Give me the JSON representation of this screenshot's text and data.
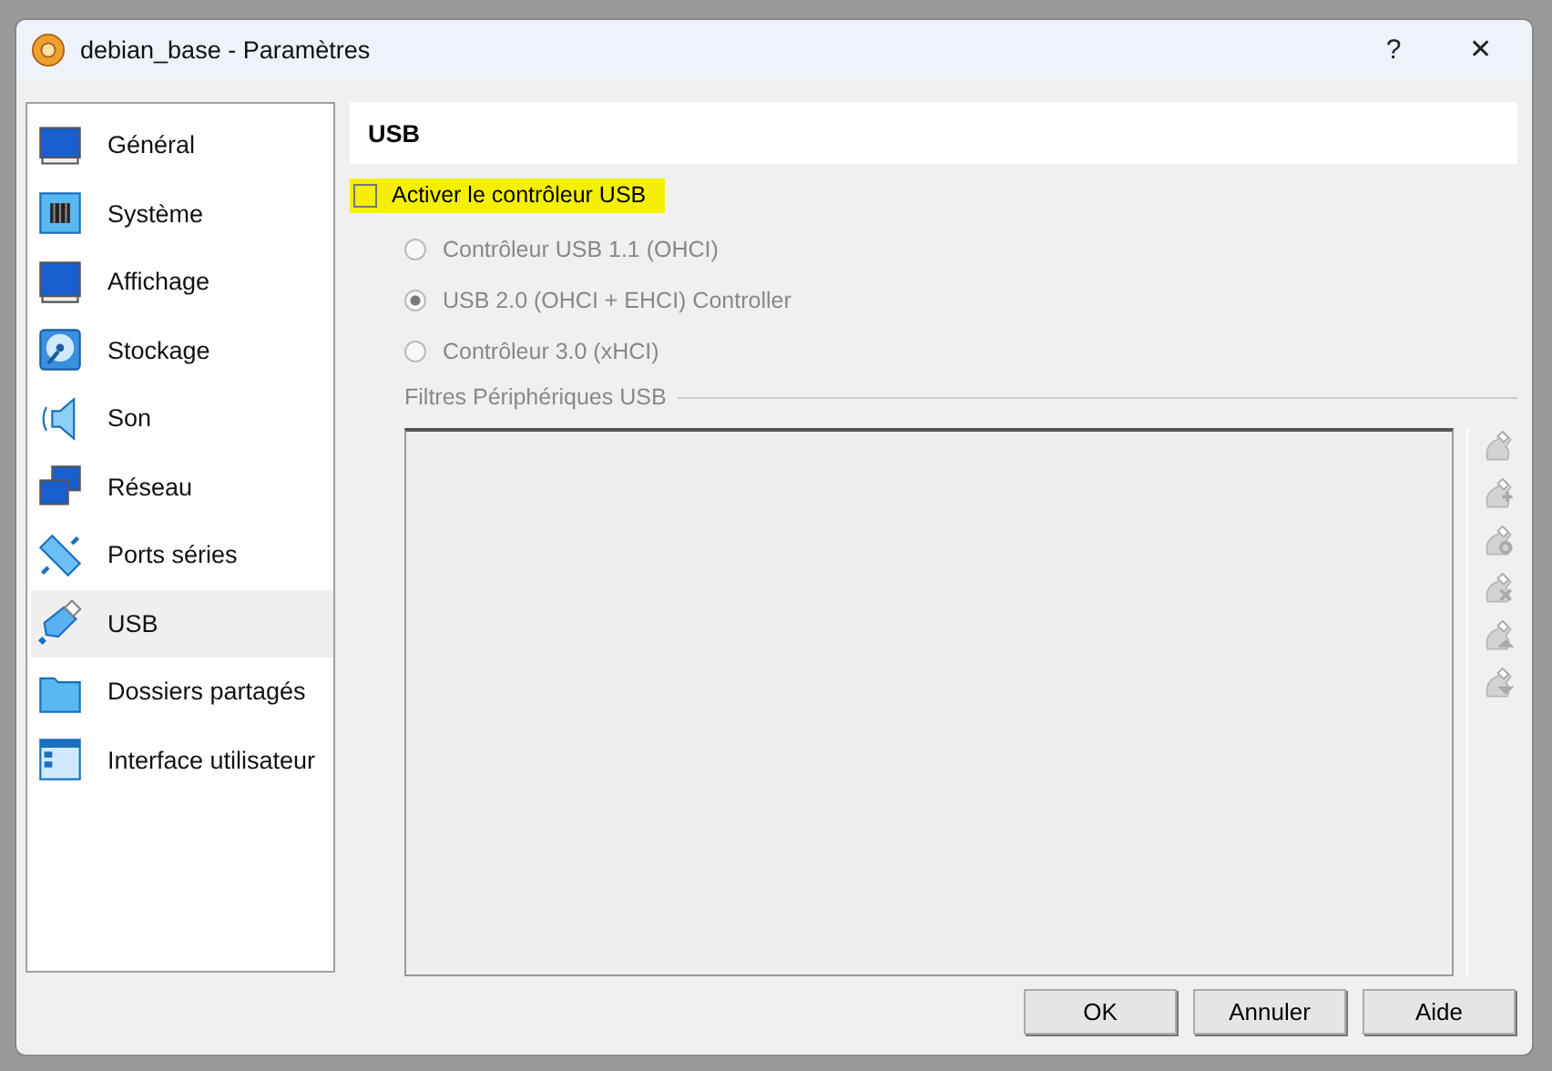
{
  "window": {
    "title": "debian_base - Paramètres",
    "help": "?",
    "close": "✕"
  },
  "sidebar": {
    "items": [
      {
        "label": "Général",
        "kind": "general",
        "selected": false
      },
      {
        "label": "Système",
        "kind": "system",
        "selected": false
      },
      {
        "label": "Affichage",
        "kind": "display",
        "selected": false
      },
      {
        "label": "Stockage",
        "kind": "storage",
        "selected": false
      },
      {
        "label": "Son",
        "kind": "audio",
        "selected": false
      },
      {
        "label": "Réseau",
        "kind": "network",
        "selected": false
      },
      {
        "label": "Ports séries",
        "kind": "serial",
        "selected": false
      },
      {
        "label": "USB",
        "kind": "usb",
        "selected": true
      },
      {
        "label": "Dossiers partagés",
        "kind": "folder",
        "selected": false
      },
      {
        "label": "Interface utilisateur",
        "kind": "ui",
        "selected": false
      }
    ]
  },
  "page": {
    "title": "USB",
    "enable": {
      "label": "Activer le contrôleur USB",
      "checked": false,
      "highlighted": true
    },
    "controllers": [
      {
        "label": "Contrôleur USB 1.1 (OHCI)",
        "selected": false,
        "disabled": true
      },
      {
        "label": "USB 2.0 (OHCI + EHCI) Controller",
        "selected": true,
        "disabled": true
      },
      {
        "label": "Contrôleur 3.0 (xHCI)",
        "selected": false,
        "disabled": true
      }
    ],
    "filters": {
      "title": "Filtres Périphériques USB",
      "disabled": true,
      "tools": [
        {
          "kind": "new",
          "disabled": true
        },
        {
          "kind": "add",
          "disabled": true
        },
        {
          "kind": "edit",
          "disabled": true
        },
        {
          "kind": "remove",
          "disabled": true
        },
        {
          "kind": "up",
          "disabled": true
        },
        {
          "kind": "down",
          "disabled": true
        }
      ]
    }
  },
  "buttons": [
    "OK",
    "Annuler",
    "Aide"
  ]
}
